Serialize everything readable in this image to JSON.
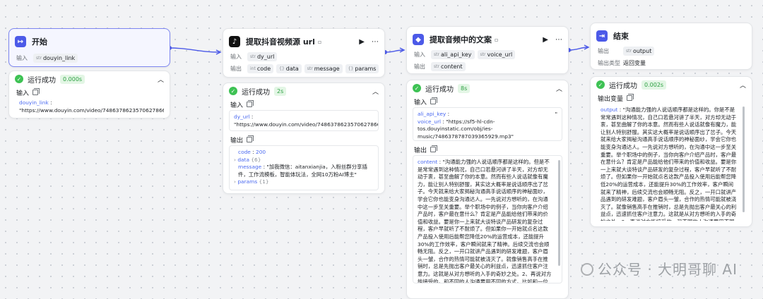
{
  "colors": {
    "accent": "#4c5ae8",
    "success": "#3ec254",
    "tiktok": "#111111"
  },
  "nodes": {
    "start": {
      "title": "开始",
      "input_label": "输入",
      "param_type": "str",
      "param": "douyin_link"
    },
    "extract": {
      "title": "提取抖音视频源 url",
      "input_label": "输入",
      "input_type": "str",
      "input": "dy_url",
      "output_label": "输出",
      "outputs": [
        {
          "type": "int",
          "name": "code"
        },
        {
          "type": "{}",
          "name": "data"
        },
        {
          "type": "str",
          "name": "message"
        },
        {
          "type": "{}",
          "name": "params"
        }
      ]
    },
    "voice": {
      "title": "提取音频中的文案",
      "input_label": "输入",
      "inputs": [
        {
          "type": "str",
          "name": "ali_api_key"
        },
        {
          "type": "str",
          "name": "voice_url"
        }
      ],
      "output_label": "输出",
      "output_type": "str",
      "output": "content"
    },
    "end": {
      "title": "结束",
      "output_label": "输出",
      "output_type": "str",
      "output": "output",
      "type_label": "输出类型",
      "type_value": "返回变量"
    }
  },
  "panels": {
    "start": {
      "status": "运行成功",
      "time": "0.000s",
      "section": "输入",
      "key": "douyin_link",
      "value": "\"https://www.douyin.com/video/7486378623570627866\""
    },
    "extract": {
      "status": "运行成功",
      "time": "2s",
      "input_section": "输入",
      "in_key": "dy_url",
      "in_value": "\"https://www.douyin.com/video/7486378623570627866\"",
      "output_section": "输出",
      "code_key": "code",
      "code_value": "200",
      "data_key": "data",
      "data_count": "{6}",
      "message_key": "message",
      "message_value": "\"加我微信：aitanxianjia，入粉丝群分享插件，工作流模板，智能体玩法，全网10万粉AI博主\"",
      "params_key": "params",
      "params_count": "{1}"
    },
    "voice": {
      "status": "运行成功",
      "time": "8s",
      "input_section": "输入",
      "key_label": "ali_api_key",
      "key_mask": "\"",
      "url_key": "voice_url",
      "url_value": "\"https://sf5-hl-cdn-tos.douyinstatic.com/obj/ies-music/7486378787039365929.mp3\"",
      "output_section": "输出",
      "content_key": "content",
      "content_value": "\"沟通能力强的人说话顺序都是这样的。但是不是常常遇到这种情况，自己口若悬河讲了半天，对方却无动于衷，甚至曲解了你的本意。然而有些人说话就像有魔力，能让别人特别舒服，其实这大概率是说话顺序出了岔子。今天就来给大家揭秘沟通高手说话顺序的神秘面纱，学会它你也能变身沟通达人。一先说对方想听的，在沟通中这一步至关重要。举个职场中的例子，当你向客户介绍产品时，客户最在意什么？肯定是产品能给他们带来的价值和收益。要是你一上来就大谈特谈产品研发的复杂过程，客户早就听了不耐烦了。但如果你一开始就点名这款产品投入使用后能帮您降低20%的运营成本，还能提升30%的工作效率，客户瞬间就来了精神。后续交流也会顺畅无阻。反之，一开口就讲产品遇到的研发难题，客户眉头一皱，合作的热情可能就被浇灭了。就像销售高手在推销时，总是先抛出客户最关心的利益点，迅速抓住客户注意力。这就是从对方想听的入手的奇妙之处。2、再说对方能接受的。和不同的人沟通要用不同的方式。比如和一位严谨的财务人员探讨预算方案，你就得用精确的数字和清晰的数据图说话。\""
    },
    "end": {
      "status": "运行成功",
      "time": "0.002s",
      "section": "输出变量",
      "key": "output",
      "value": "\"沟通能力强的人说话顺序都是这样的。你是不是常常遇到这种情况，自己口若悬河讲了半天，对方却无动于衷，甚至曲解了你的本意。然而有些人说话就像有魔力，能让别人特别舒服。其实这大概率是说话顺序出了岔子。今天就来给大家揭秘沟通高手说话顺序的神秘面纱，学会它你也能变身沟通达人。一先说对方想听的，在沟通中这一步至关重要。举个职场中的例子，当你向客户介绍产品时，客户最在意什么？肯定是产品能给他们带来的价值和收益。要是你一上来就大谈特谈产品研发的复杂过程，客户早就听了不耐烦了。但如果你一开始就点名这款产品投入使用后能帮您降低20%的运营成本，还能提升30%的工作效率，客户瞬间就来了精神，后续交流也会顺畅无阻。反之，一开口就讲产品遇到的研发难题，客户眉头一皱，合作的热情可能就被浇灭了。就像销售高手在推销时，总是先抛出客户最关心的利益点，迅速抓住客户注意力。这就是从对方想听的入手的奇妙之处。2、再说对方能接受的。和不同的人沟通要用不同的方式。比如和一位严谨的财务人员探讨预算方案，你就得用精确的数字和清晰的数据图说话。\""
    }
  },
  "watermark": "公众号 · 大明哥聊 AI"
}
